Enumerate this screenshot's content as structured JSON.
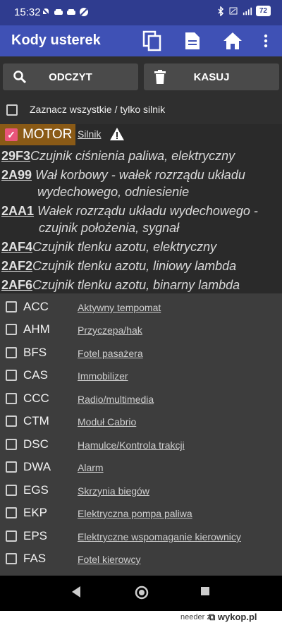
{
  "status": {
    "time": "15:32",
    "battery": "72"
  },
  "appbar": {
    "title": "Kody usterek"
  },
  "buttons": {
    "read_label": "ODCZYT",
    "clear_label": "KASUJ"
  },
  "select_all": {
    "label": "Zaznacz wszystkie / tylko silnik"
  },
  "motor": {
    "name": "MOTOR",
    "link": "Silnik",
    "faults": [
      {
        "code": "29F3",
        "desc": "Czujnik ciśnienia paliwa, elektryczny"
      },
      {
        "code": "2A99",
        "desc": "Wał korbowy - wałek rozrządu układu",
        "desc2": "wydechowego, odniesienie"
      },
      {
        "code": "2AA1",
        "desc": "Wałek rozrządu układu wydechowego -",
        "desc2": "czujnik położenia, sygnał"
      },
      {
        "code": "2AF4",
        "desc": "Czujnik tlenku azotu, elektryczny"
      },
      {
        "code": "2AF2",
        "desc": "Czujnik tlenku azotu, liniowy lambda"
      },
      {
        "code": "2AF6",
        "desc": "Czujnik tlenku azotu, binarny lambda"
      }
    ]
  },
  "modules": [
    {
      "code": "ACC",
      "label": "Aktywny tempomat"
    },
    {
      "code": "AHM",
      "label": "Przyczepa/hak"
    },
    {
      "code": "BFS",
      "label": "Fotel pasażera"
    },
    {
      "code": "CAS",
      "label": "Immobilizer"
    },
    {
      "code": "CCC",
      "label": "Radio/multimedia"
    },
    {
      "code": "CTM",
      "label": "Moduł Cabrio"
    },
    {
      "code": "DSC",
      "label": "Hamulce/Kontrola trakcji"
    },
    {
      "code": "DWA",
      "label": "Alarm"
    },
    {
      "code": "EGS",
      "label": "Skrzynia biegów"
    },
    {
      "code": "EKP",
      "label": "Elektryczna pompa paliwa"
    },
    {
      "code": "EPS",
      "label": "Elektryczne wspomaganie kierownicy"
    },
    {
      "code": "FAS",
      "label": "Fotel kierowcy"
    }
  ],
  "watermark": {
    "user": "needer",
    "suffix": "z",
    "site": "wykop.pl"
  },
  "colors": {
    "statusbar": "#2f3c8f",
    "appbar": "#3f51b5",
    "motor_header": "#8a5a16",
    "checkbox_checked": "#e9557a"
  }
}
